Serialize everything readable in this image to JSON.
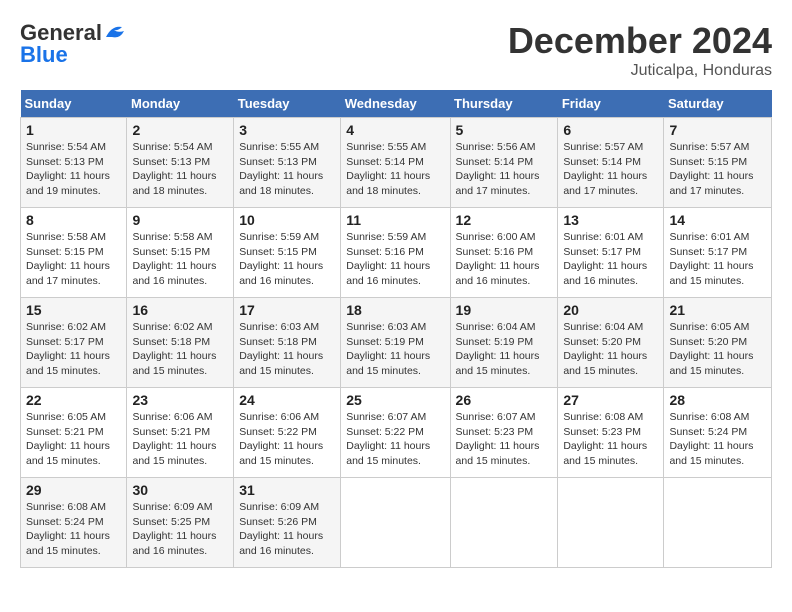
{
  "header": {
    "logo_line1": "General",
    "logo_line2": "Blue",
    "month_title": "December 2024",
    "subtitle": "Juticalpa, Honduras"
  },
  "weekdays": [
    "Sunday",
    "Monday",
    "Tuesday",
    "Wednesday",
    "Thursday",
    "Friday",
    "Saturday"
  ],
  "weeks": [
    [
      {
        "day": "1",
        "sunrise": "5:54 AM",
        "sunset": "5:13 PM",
        "daylight": "11 hours and 19 minutes."
      },
      {
        "day": "2",
        "sunrise": "5:54 AM",
        "sunset": "5:13 PM",
        "daylight": "11 hours and 18 minutes."
      },
      {
        "day": "3",
        "sunrise": "5:55 AM",
        "sunset": "5:13 PM",
        "daylight": "11 hours and 18 minutes."
      },
      {
        "day": "4",
        "sunrise": "5:55 AM",
        "sunset": "5:14 PM",
        "daylight": "11 hours and 18 minutes."
      },
      {
        "day": "5",
        "sunrise": "5:56 AM",
        "sunset": "5:14 PM",
        "daylight": "11 hours and 17 minutes."
      },
      {
        "day": "6",
        "sunrise": "5:57 AM",
        "sunset": "5:14 PM",
        "daylight": "11 hours and 17 minutes."
      },
      {
        "day": "7",
        "sunrise": "5:57 AM",
        "sunset": "5:15 PM",
        "daylight": "11 hours and 17 minutes."
      }
    ],
    [
      {
        "day": "8",
        "sunrise": "5:58 AM",
        "sunset": "5:15 PM",
        "daylight": "11 hours and 17 minutes."
      },
      {
        "day": "9",
        "sunrise": "5:58 AM",
        "sunset": "5:15 PM",
        "daylight": "11 hours and 16 minutes."
      },
      {
        "day": "10",
        "sunrise": "5:59 AM",
        "sunset": "5:15 PM",
        "daylight": "11 hours and 16 minutes."
      },
      {
        "day": "11",
        "sunrise": "5:59 AM",
        "sunset": "5:16 PM",
        "daylight": "11 hours and 16 minutes."
      },
      {
        "day": "12",
        "sunrise": "6:00 AM",
        "sunset": "5:16 PM",
        "daylight": "11 hours and 16 minutes."
      },
      {
        "day": "13",
        "sunrise": "6:01 AM",
        "sunset": "5:17 PM",
        "daylight": "11 hours and 16 minutes."
      },
      {
        "day": "14",
        "sunrise": "6:01 AM",
        "sunset": "5:17 PM",
        "daylight": "11 hours and 15 minutes."
      }
    ],
    [
      {
        "day": "15",
        "sunrise": "6:02 AM",
        "sunset": "5:17 PM",
        "daylight": "11 hours and 15 minutes."
      },
      {
        "day": "16",
        "sunrise": "6:02 AM",
        "sunset": "5:18 PM",
        "daylight": "11 hours and 15 minutes."
      },
      {
        "day": "17",
        "sunrise": "6:03 AM",
        "sunset": "5:18 PM",
        "daylight": "11 hours and 15 minutes."
      },
      {
        "day": "18",
        "sunrise": "6:03 AM",
        "sunset": "5:19 PM",
        "daylight": "11 hours and 15 minutes."
      },
      {
        "day": "19",
        "sunrise": "6:04 AM",
        "sunset": "5:19 PM",
        "daylight": "11 hours and 15 minutes."
      },
      {
        "day": "20",
        "sunrise": "6:04 AM",
        "sunset": "5:20 PM",
        "daylight": "11 hours and 15 minutes."
      },
      {
        "day": "21",
        "sunrise": "6:05 AM",
        "sunset": "5:20 PM",
        "daylight": "11 hours and 15 minutes."
      }
    ],
    [
      {
        "day": "22",
        "sunrise": "6:05 AM",
        "sunset": "5:21 PM",
        "daylight": "11 hours and 15 minutes."
      },
      {
        "day": "23",
        "sunrise": "6:06 AM",
        "sunset": "5:21 PM",
        "daylight": "11 hours and 15 minutes."
      },
      {
        "day": "24",
        "sunrise": "6:06 AM",
        "sunset": "5:22 PM",
        "daylight": "11 hours and 15 minutes."
      },
      {
        "day": "25",
        "sunrise": "6:07 AM",
        "sunset": "5:22 PM",
        "daylight": "11 hours and 15 minutes."
      },
      {
        "day": "26",
        "sunrise": "6:07 AM",
        "sunset": "5:23 PM",
        "daylight": "11 hours and 15 minutes."
      },
      {
        "day": "27",
        "sunrise": "6:08 AM",
        "sunset": "5:23 PM",
        "daylight": "11 hours and 15 minutes."
      },
      {
        "day": "28",
        "sunrise": "6:08 AM",
        "sunset": "5:24 PM",
        "daylight": "11 hours and 15 minutes."
      }
    ],
    [
      {
        "day": "29",
        "sunrise": "6:08 AM",
        "sunset": "5:24 PM",
        "daylight": "11 hours and 15 minutes."
      },
      {
        "day": "30",
        "sunrise": "6:09 AM",
        "sunset": "5:25 PM",
        "daylight": "11 hours and 16 minutes."
      },
      {
        "day": "31",
        "sunrise": "6:09 AM",
        "sunset": "5:26 PM",
        "daylight": "11 hours and 16 minutes."
      },
      null,
      null,
      null,
      null
    ]
  ],
  "labels": {
    "sunrise": "Sunrise:",
    "sunset": "Sunset:",
    "daylight": "Daylight:"
  }
}
